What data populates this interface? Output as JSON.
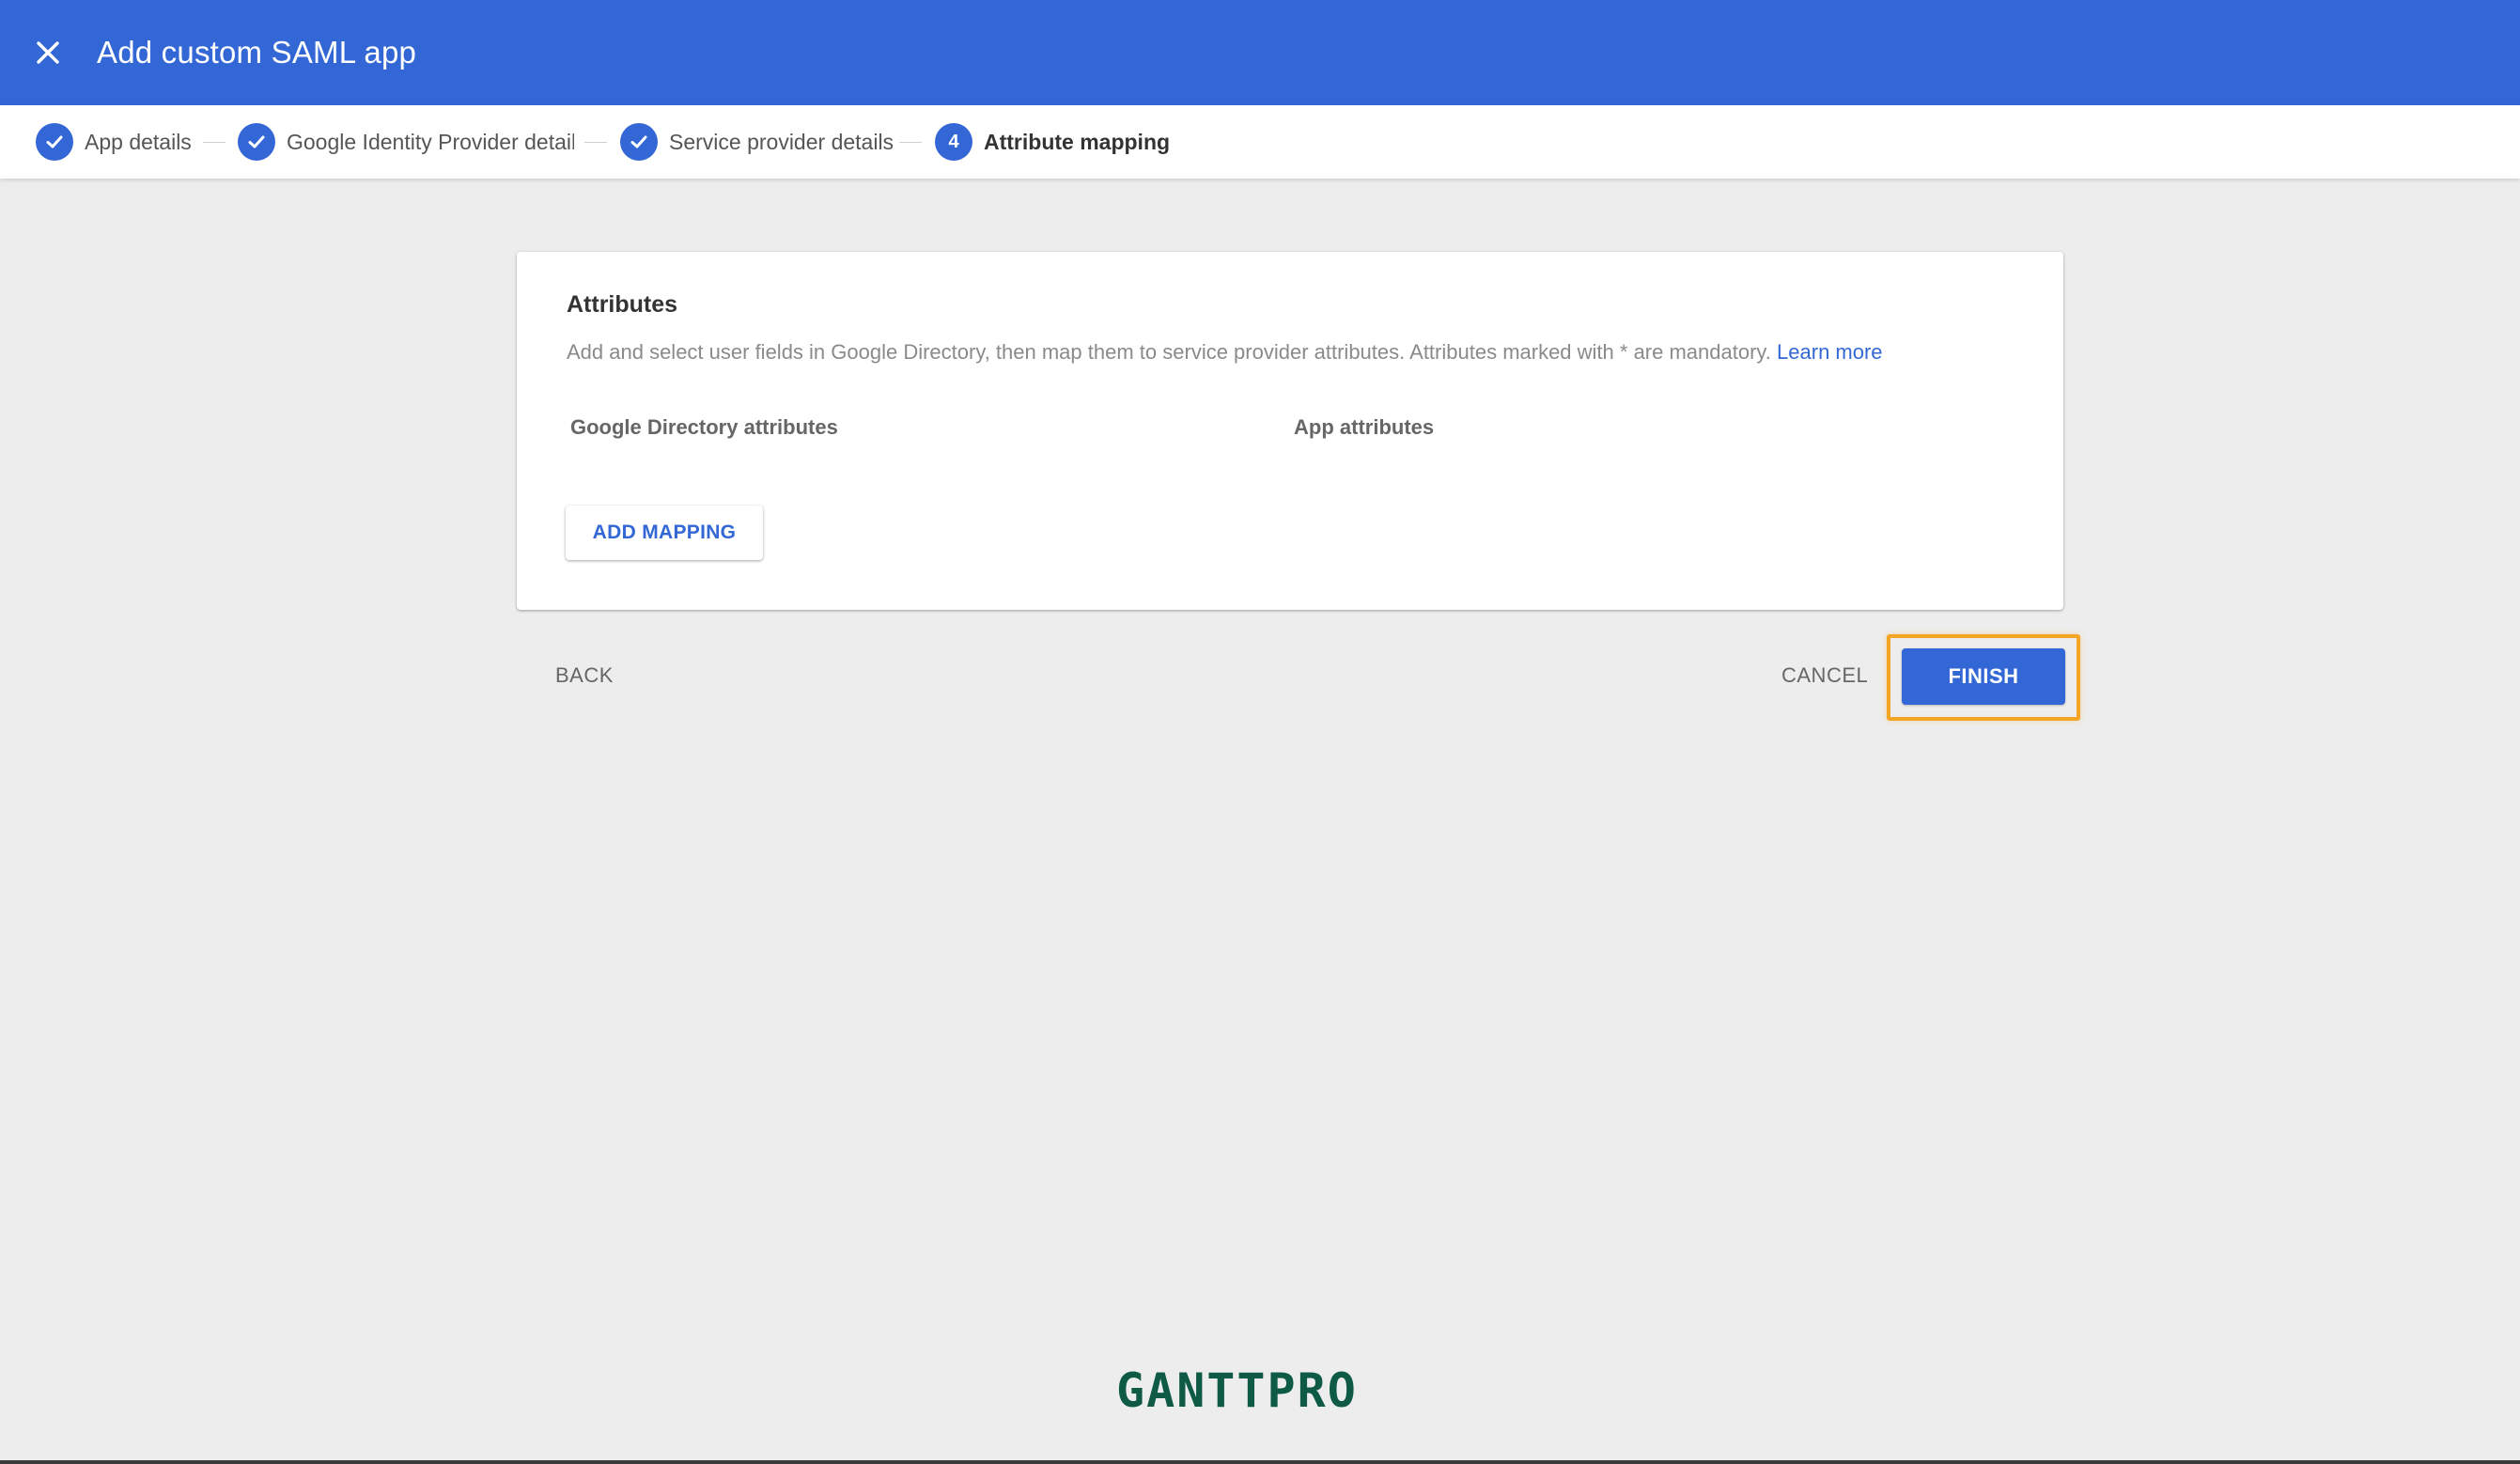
{
  "header": {
    "title": "Add custom SAML app",
    "close_icon": "close-icon"
  },
  "stepper": {
    "steps": [
      {
        "label": "App details",
        "state": "done"
      },
      {
        "label": "Google Identity Provider details",
        "state": "done"
      },
      {
        "label": "Service provider details",
        "state": "done"
      },
      {
        "number": "4",
        "label": "Attribute mapping",
        "state": "active"
      }
    ]
  },
  "card": {
    "title": "Attributes",
    "description": "Add and select user fields in Google Directory, then map them to service provider attributes. Attributes marked with * are mandatory.",
    "learn_more": "Learn more",
    "col_directory": "Google Directory attributes",
    "col_app": "App attributes",
    "add_mapping": "ADD MAPPING"
  },
  "footer_actions": {
    "back": "BACK",
    "cancel": "CANCEL",
    "finish": "FINISH"
  },
  "watermark": "GANTTPRO",
  "colors": {
    "primary": "#3367d6",
    "highlight": "#f5a524",
    "background": "#ededed",
    "logo": "#0f5a45"
  }
}
